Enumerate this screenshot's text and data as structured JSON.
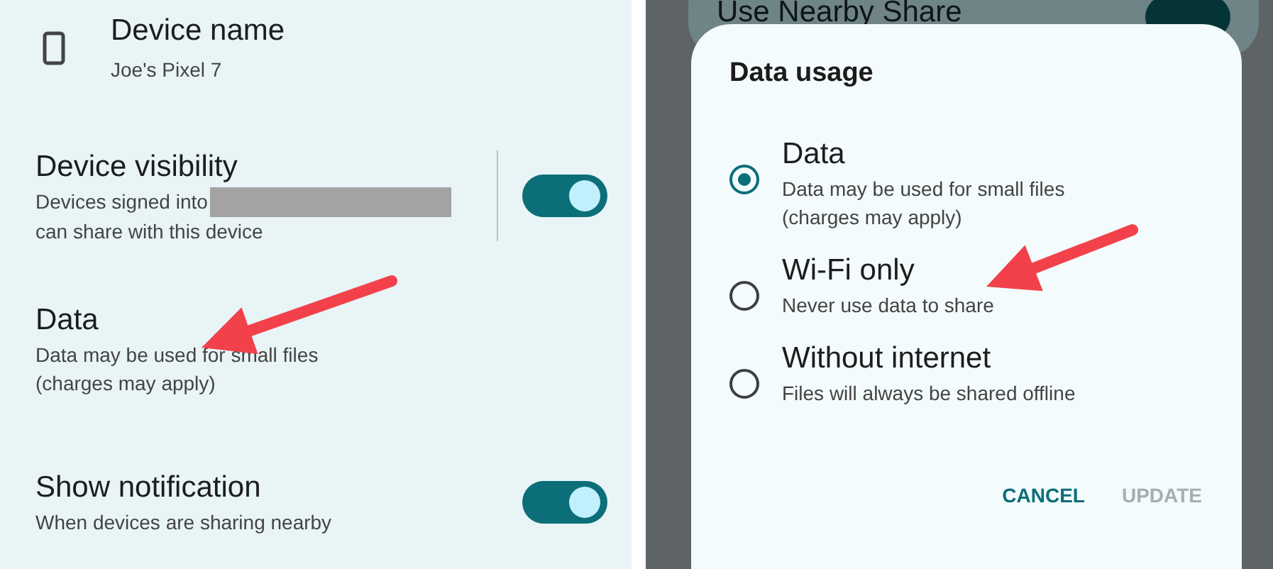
{
  "device_name": {
    "title": "Device name",
    "value": "Joe's Pixel 7"
  },
  "settings": [
    {
      "kind": "toggle",
      "title": "Device visibility",
      "description": [
        "Devices signed into",
        "can share with this device"
      ],
      "redacted": true,
      "divider": true,
      "on": true
    },
    {
      "kind": "plain",
      "title": "Data",
      "description": [
        "Data may be used for small files",
        "(charges may apply)"
      ],
      "redacted": false,
      "divider": false
    },
    {
      "kind": "toggle",
      "title": "Show notification",
      "description": [
        "When devices are sharing nearby"
      ],
      "redacted": false,
      "divider": false,
      "on": true
    }
  ],
  "background": {
    "title": "Use Nearby Share",
    "on": true
  },
  "dialog": {
    "title": "Data usage",
    "options": [
      {
        "label": "Data",
        "description": [
          "Data may be used for small files",
          "(charges may apply)"
        ],
        "selected": true
      },
      {
        "label": "Wi-Fi only",
        "description": [
          "Never use data to share"
        ],
        "selected": false
      },
      {
        "label": "Without internet",
        "description": [
          "Files will always be shared offline"
        ],
        "selected": false
      }
    ],
    "buttons": [
      {
        "label": "CANCEL",
        "disabled": false
      },
      {
        "label": "UPDATE",
        "disabled": true
      }
    ]
  }
}
